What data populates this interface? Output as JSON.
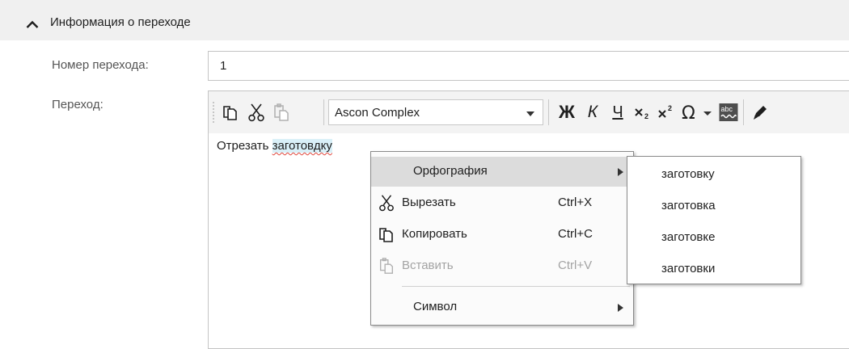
{
  "section": {
    "title": "Информация о переходе",
    "icon": "chevron-up-icon"
  },
  "fields": {
    "number_label": "Номер перехода:",
    "number_value": "1",
    "transition_label": "Переход:"
  },
  "toolbar": {
    "font_name": "Ascon Complex",
    "bold_label": "Ж",
    "italic_label": "К",
    "underline_label": "Ч",
    "spellcheck_label": "abc",
    "icons": [
      "copy-icon",
      "cut-icon",
      "paste-icon",
      "bold-icon",
      "italic-icon",
      "underline-icon",
      "subscript-icon",
      "superscript-icon",
      "omega-icon",
      "spellcheck-icon",
      "pencil-icon"
    ]
  },
  "editor": {
    "text_before": "Отрезать ",
    "misspelled_word": "заготовдку"
  },
  "context_menu": {
    "items": [
      {
        "label": "Орфография",
        "shortcut": "",
        "submenu": true,
        "highlighted": true
      },
      {
        "label": "Вырезать",
        "shortcut": "Ctrl+X",
        "icon": "cut-icon"
      },
      {
        "label": "Копировать",
        "shortcut": "Ctrl+C",
        "icon": "copy-icon"
      },
      {
        "label": "Вставить",
        "shortcut": "Ctrl+V",
        "icon": "paste-icon",
        "disabled": true
      },
      {
        "label": "Символ",
        "shortcut": "",
        "submenu": true
      }
    ]
  },
  "suggestions": [
    "заготовку",
    "заготовка",
    "заготовке",
    "заготовки"
  ],
  "colors": {
    "header_bg": "#f0f0f0",
    "highlight": "#dcdcdc",
    "selection": "#d9f0f8",
    "spell_error": "#e0453a"
  }
}
